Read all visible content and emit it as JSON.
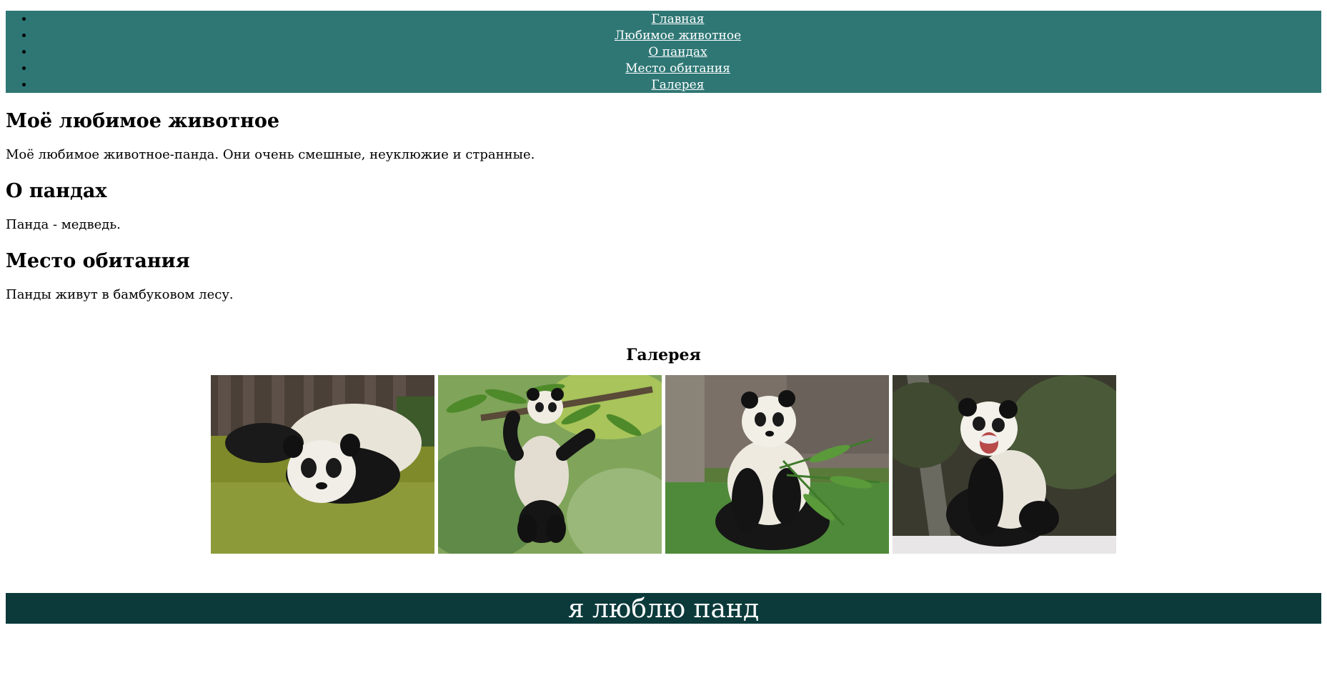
{
  "nav": {
    "items": [
      {
        "label": "Главная"
      },
      {
        "label": "Любимое животное"
      },
      {
        "label": "О пандах"
      },
      {
        "label": "Место обитания"
      },
      {
        "label": "Галерея"
      }
    ]
  },
  "sections": [
    {
      "title": "Моё любимое животное",
      "text": "Моё любимое животное-панда. Они очень смешные, неуклюжие и странные."
    },
    {
      "title": "О пандах",
      "text": "Панда - медведь."
    },
    {
      "title": "Место обитания",
      "text": "Панды живут в бамбуковом лесу."
    }
  ],
  "gallery": {
    "title": "Галерея",
    "photos": [
      {
        "name": "panda-lying-in-water-photo"
      },
      {
        "name": "panda-hanging-on-branch-photo"
      },
      {
        "name": "panda-eating-bamboo-photo"
      },
      {
        "name": "panda-yawning-photo"
      }
    ]
  },
  "footer": {
    "text": "я люблю панд"
  },
  "colors": {
    "nav_bg": "#2e7775",
    "footer_bg": "#0c3a3b"
  }
}
